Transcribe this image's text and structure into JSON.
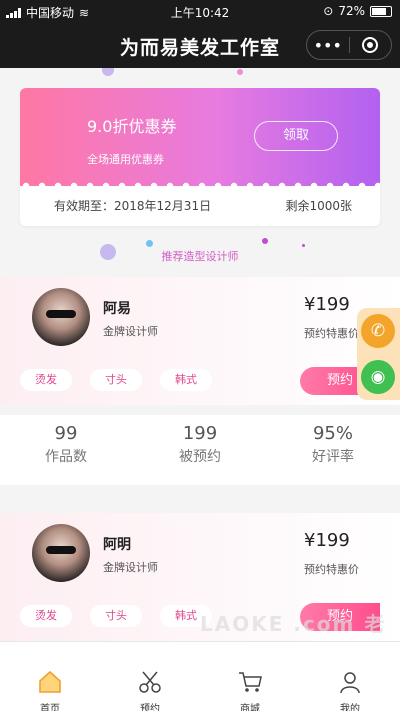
{
  "status_bar": {
    "carrier": "中国移动",
    "time": "上午10:42",
    "battery": "72%"
  },
  "nav": {
    "title": "为而易美发工作室"
  },
  "coupon": {
    "name": "9.0折优惠券",
    "desc": "全场通用优惠券",
    "claim_label": "领取",
    "valid": "有效期至：2018年12月31日",
    "remain": "剩余1000张"
  },
  "section": {
    "title": "推荐造型设计师"
  },
  "designers": [
    {
      "name": "阿易",
      "title": "金牌设计师",
      "price": "¥199",
      "price_label": "预约特惠价",
      "tags": [
        "烫发",
        "寸头",
        "韩式"
      ],
      "book": "预约"
    },
    {
      "name": "阿明",
      "title": "金牌设计师",
      "price": "¥199",
      "price_label": "预约特惠价",
      "tags": [
        "烫发",
        "寸头",
        "韩式"
      ],
      "book": "预约"
    }
  ],
  "stats": [
    {
      "num": "99",
      "label": "作品数"
    },
    {
      "num": "199",
      "label": "被预约"
    },
    {
      "num": "95%",
      "label": "好评率"
    }
  ],
  "tabs": [
    {
      "label": "首页",
      "icon": "home-icon",
      "active": true
    },
    {
      "label": "预约",
      "icon": "scissors-icon"
    },
    {
      "label": "商城",
      "icon": "cart-icon"
    },
    {
      "label": "我的",
      "icon": "user-icon"
    }
  ],
  "watermark": "LAOKE .com 老客",
  "colors": {
    "accent": "#ff4d8d",
    "tab_active": "#f0a030",
    "phone": "#f3a52b",
    "wechat": "#3fc051"
  }
}
